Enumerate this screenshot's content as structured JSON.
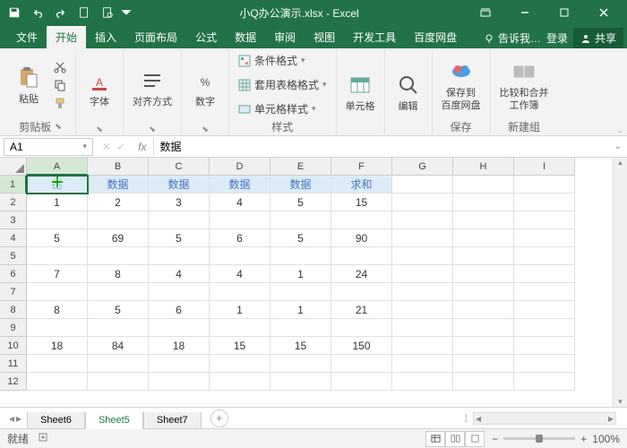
{
  "app_title": "小Q办公演示.xlsx - Excel",
  "tabs": {
    "file": "文件",
    "home": "开始",
    "insert": "插入",
    "layout": "页面布局",
    "formulas": "公式",
    "data": "数据",
    "review": "审阅",
    "view": "视图",
    "dev": "开发工具",
    "baidu": "百度网盘",
    "tell": "告诉我…",
    "login": "登录",
    "share": "共享"
  },
  "ribbon": {
    "clipboard": {
      "paste": "粘贴",
      "label": "剪贴板"
    },
    "font": {
      "btn": "字体",
      "label": "字体"
    },
    "align": {
      "btn": "对齐方式",
      "label": "对齐方式"
    },
    "number": {
      "btn": "数字",
      "label": "数字"
    },
    "styles": {
      "cond": "条件格式",
      "table": "套用表格格式",
      "cell": "单元格样式",
      "label": "样式"
    },
    "cells": {
      "btn": "单元格",
      "label": "单元格"
    },
    "editing": {
      "btn": "编辑",
      "label": "编辑"
    },
    "save": {
      "btn": "保存到\n百度网盘",
      "label": "保存"
    },
    "compare": {
      "btn": "比较和合并\n工作簿",
      "label": "新建组"
    }
  },
  "namebox": "A1",
  "formula": "数据",
  "headers": [
    "数据",
    "数据",
    "数据",
    "数据",
    "数据",
    "求和"
  ],
  "rows": [
    [
      "1",
      "2",
      "3",
      "4",
      "5",
      "15"
    ],
    [
      "",
      "",
      "",
      "",
      "",
      ""
    ],
    [
      "5",
      "69",
      "5",
      "6",
      "5",
      "90"
    ],
    [
      "",
      "",
      "",
      "",
      "",
      ""
    ],
    [
      "7",
      "8",
      "4",
      "4",
      "1",
      "24"
    ],
    [
      "",
      "",
      "",
      "",
      "",
      ""
    ],
    [
      "8",
      "5",
      "6",
      "1",
      "1",
      "21"
    ],
    [
      "",
      "",
      "",
      "",
      "",
      ""
    ],
    [
      "18",
      "84",
      "18",
      "15",
      "15",
      "150"
    ],
    [
      "",
      "",
      "",
      "",
      "",
      ""
    ],
    [
      "",
      "",
      "",
      "",
      "",
      ""
    ]
  ],
  "cols": [
    "A",
    "B",
    "C",
    "D",
    "E",
    "F",
    "G",
    "H",
    "I"
  ],
  "sheets": [
    "Sheet6",
    "Sheet5",
    "Sheet7"
  ],
  "active_sheet": 1,
  "status": "就绪",
  "zoom": "100%"
}
